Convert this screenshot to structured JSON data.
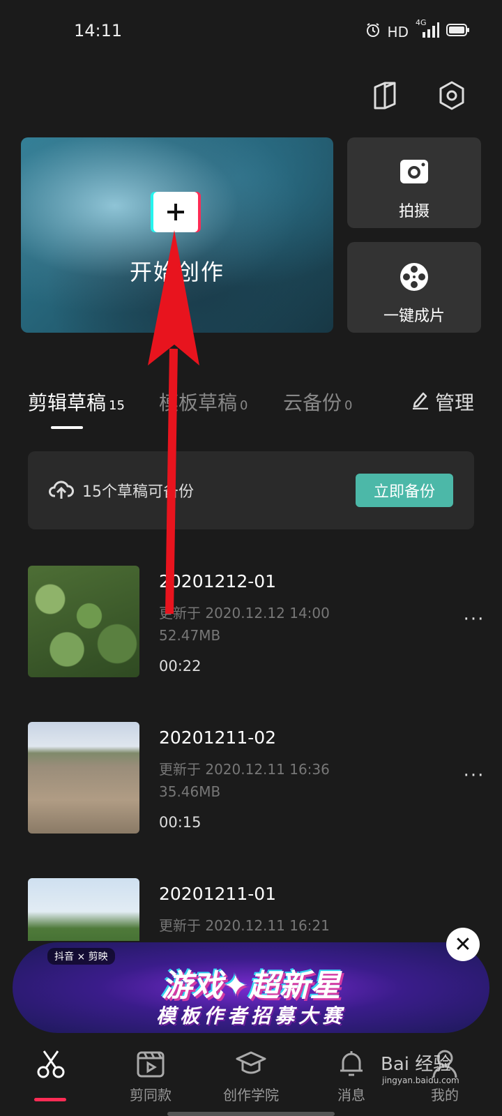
{
  "status_bar": {
    "time": "14:11",
    "hd": "HD",
    "network": "4G"
  },
  "hero": {
    "label": "开始创作"
  },
  "side_cards": [
    {
      "label": "拍摄"
    },
    {
      "label": "一键成片"
    }
  ],
  "tabs": [
    {
      "label": "剪辑草稿",
      "count": "15"
    },
    {
      "label": "模板草稿",
      "count": "0"
    },
    {
      "label": "云备份",
      "count": "0"
    }
  ],
  "manage_label": "管理",
  "backup": {
    "text": "15个草稿可备份",
    "button": "立即备份"
  },
  "drafts": [
    {
      "title": "20201212-01",
      "updated": "更新于 2020.12.12 14:00",
      "size": "52.47MB",
      "duration": "00:22"
    },
    {
      "title": "20201211-02",
      "updated": "更新于 2020.12.11 16:36",
      "size": "35.46MB",
      "duration": "00:15"
    },
    {
      "title": "20201211-01",
      "updated": "更新于 2020.12.11 16:21"
    }
  ],
  "more_label": "···",
  "banner": {
    "brand": "抖音 × 剪映",
    "title": "游戏✦超新星",
    "subtitle": "模板作者招募大赛",
    "close": "✕"
  },
  "nav": [
    {
      "label": ""
    },
    {
      "label": "剪同款"
    },
    {
      "label": "创作学院"
    },
    {
      "label": "消息"
    },
    {
      "label": "我的"
    }
  ],
  "watermark": {
    "main": "Bai 经验",
    "sub": "jingyan.baidu.com"
  },
  "colors": {
    "accent": "#4cb8a8",
    "active_indicator": "#fe2c55",
    "arrow": "#e8141e"
  }
}
